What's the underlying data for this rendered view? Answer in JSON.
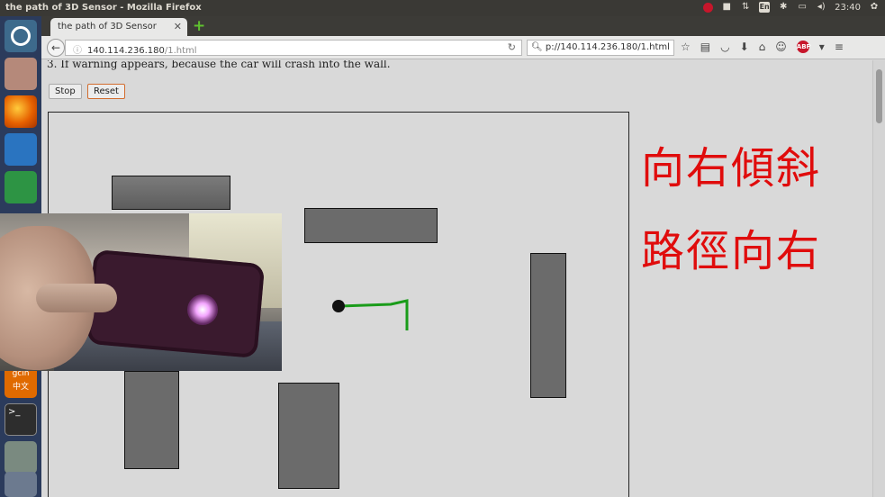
{
  "top_panel": {
    "window_title": "the path of 3D Sensor - Mozilla Firefox",
    "keyboard_layout": "En",
    "clock": "23:40"
  },
  "browser": {
    "tab_title": "the path of 3D Sensor",
    "url_host": "140.114.236.180",
    "url_path": "/1.html",
    "search_text": "p://140.114.236.180/1.html"
  },
  "page": {
    "warning_text": "3. If warning appears, because the car will crash into the wall.",
    "stop_label": "Stop",
    "reset_label": "Reset",
    "status_tilt": "向右傾斜",
    "status_path": "路徑向右"
  },
  "ime": {
    "label": "gcin",
    "lang": "中文"
  },
  "terminal_prompt": ">_",
  "colors": {
    "status_text": "#e00c0c",
    "path_line": "#1a9c1a",
    "wall": "#6b6b6b",
    "car": "#111111"
  }
}
